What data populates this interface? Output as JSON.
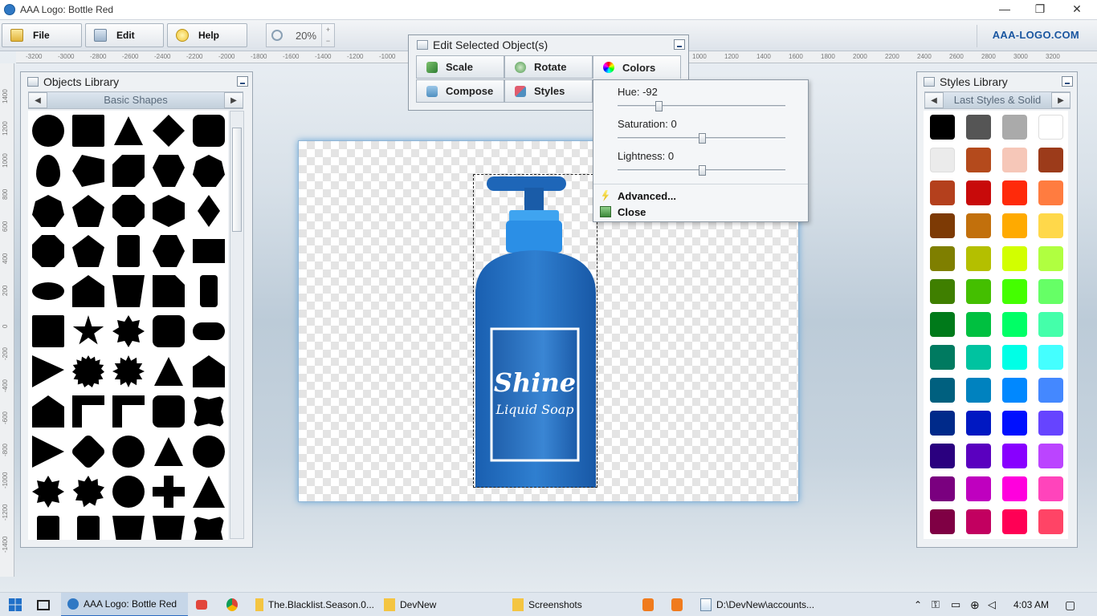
{
  "window": {
    "title": "AAA Logo: Bottle Red",
    "minimize": "—",
    "restore": "❐",
    "close": "✕"
  },
  "toolbar": {
    "file": "File",
    "edit": "Edit",
    "help": "Help",
    "zoom": "20%",
    "zoom_up": "+",
    "zoom_down": "−",
    "brand": "AAA-LOGO.COM"
  },
  "ruler": {
    "h_ticks": [
      "-3200",
      "-3000",
      "-2800",
      "-2600",
      "-2400",
      "-2200",
      "-2000",
      "-1800",
      "-1600",
      "-1400",
      "-1200",
      "-1000",
      "1000",
      "1200",
      "1400",
      "1600",
      "1800",
      "2000",
      "2200",
      "2400",
      "2600",
      "2800",
      "3000",
      "3200"
    ],
    "v_ticks": [
      "1400",
      "1200",
      "1000",
      "800",
      "600",
      "400",
      "200",
      "0",
      "-200",
      "-400",
      "-600",
      "-800",
      "-1000",
      "-1200",
      "-1400"
    ]
  },
  "objects_library": {
    "title": "Objects Library",
    "category": "Basic Shapes",
    "prev": "◀",
    "next": "▶"
  },
  "edit_dialog": {
    "title": "Edit Selected Object(s)",
    "buttons": {
      "scale": "Scale",
      "rotate": "Rotate",
      "colors": "Colors",
      "compose": "Compose",
      "styles": "Styles"
    }
  },
  "colors_popup": {
    "hue_label": "Hue: -92",
    "saturation_label": "Saturation: 0",
    "lightness_label": "Lightness: 0",
    "hue": -92,
    "saturation": 0,
    "lightness": 0,
    "advanced": "Advanced...",
    "close": "Close"
  },
  "canvas": {
    "text_main": "Shine",
    "text_sub": "Liquid Soap"
  },
  "styles_library": {
    "title": "Styles Library",
    "category": "Last Styles & Solid",
    "prev": "◀",
    "next": "▶",
    "swatches": [
      [
        "#000000",
        "#555555",
        "#aaaaaa",
        "#ffffff"
      ],
      [
        "#ebebeb",
        "#b44a1c",
        "#f6c7b8",
        "#9c3b1a"
      ],
      [
        "#b4401d",
        "#c80a0a",
        "#ff2a0a",
        "#ff7c40"
      ],
      [
        "#7d3a05",
        "#c2700c",
        "#ffaa00",
        "#ffd84a"
      ],
      [
        "#7f7f00",
        "#b4bf00",
        "#d2ff00",
        "#b0ff40"
      ],
      [
        "#3f7f00",
        "#44bf00",
        "#44ff00",
        "#66ff66"
      ],
      [
        "#007a1a",
        "#00c040",
        "#00ff66",
        "#44ffaa"
      ],
      [
        "#007a60",
        "#00c3a0",
        "#00ffe6",
        "#44ffff"
      ],
      [
        "#00607f",
        "#0082bf",
        "#0088ff",
        "#4488ff"
      ],
      [
        "#002a8a",
        "#0018c2",
        "#0010ff",
        "#6644ff"
      ],
      [
        "#2a007f",
        "#5a00bf",
        "#8800ff",
        "#bb44ff"
      ],
      [
        "#7a007f",
        "#bf00bf",
        "#ff00dd",
        "#ff44bb"
      ],
      [
        "#7f0044",
        "#c20060",
        "#ff0055",
        "#ff4466"
      ]
    ]
  },
  "taskbar": {
    "items": [
      "AAA Logo: Bottle Red",
      "The.Blacklist.Season.0...",
      "DevNew",
      "Screenshots",
      "D:\\DevNew\\accounts..."
    ],
    "clock": "4:03 AM"
  }
}
